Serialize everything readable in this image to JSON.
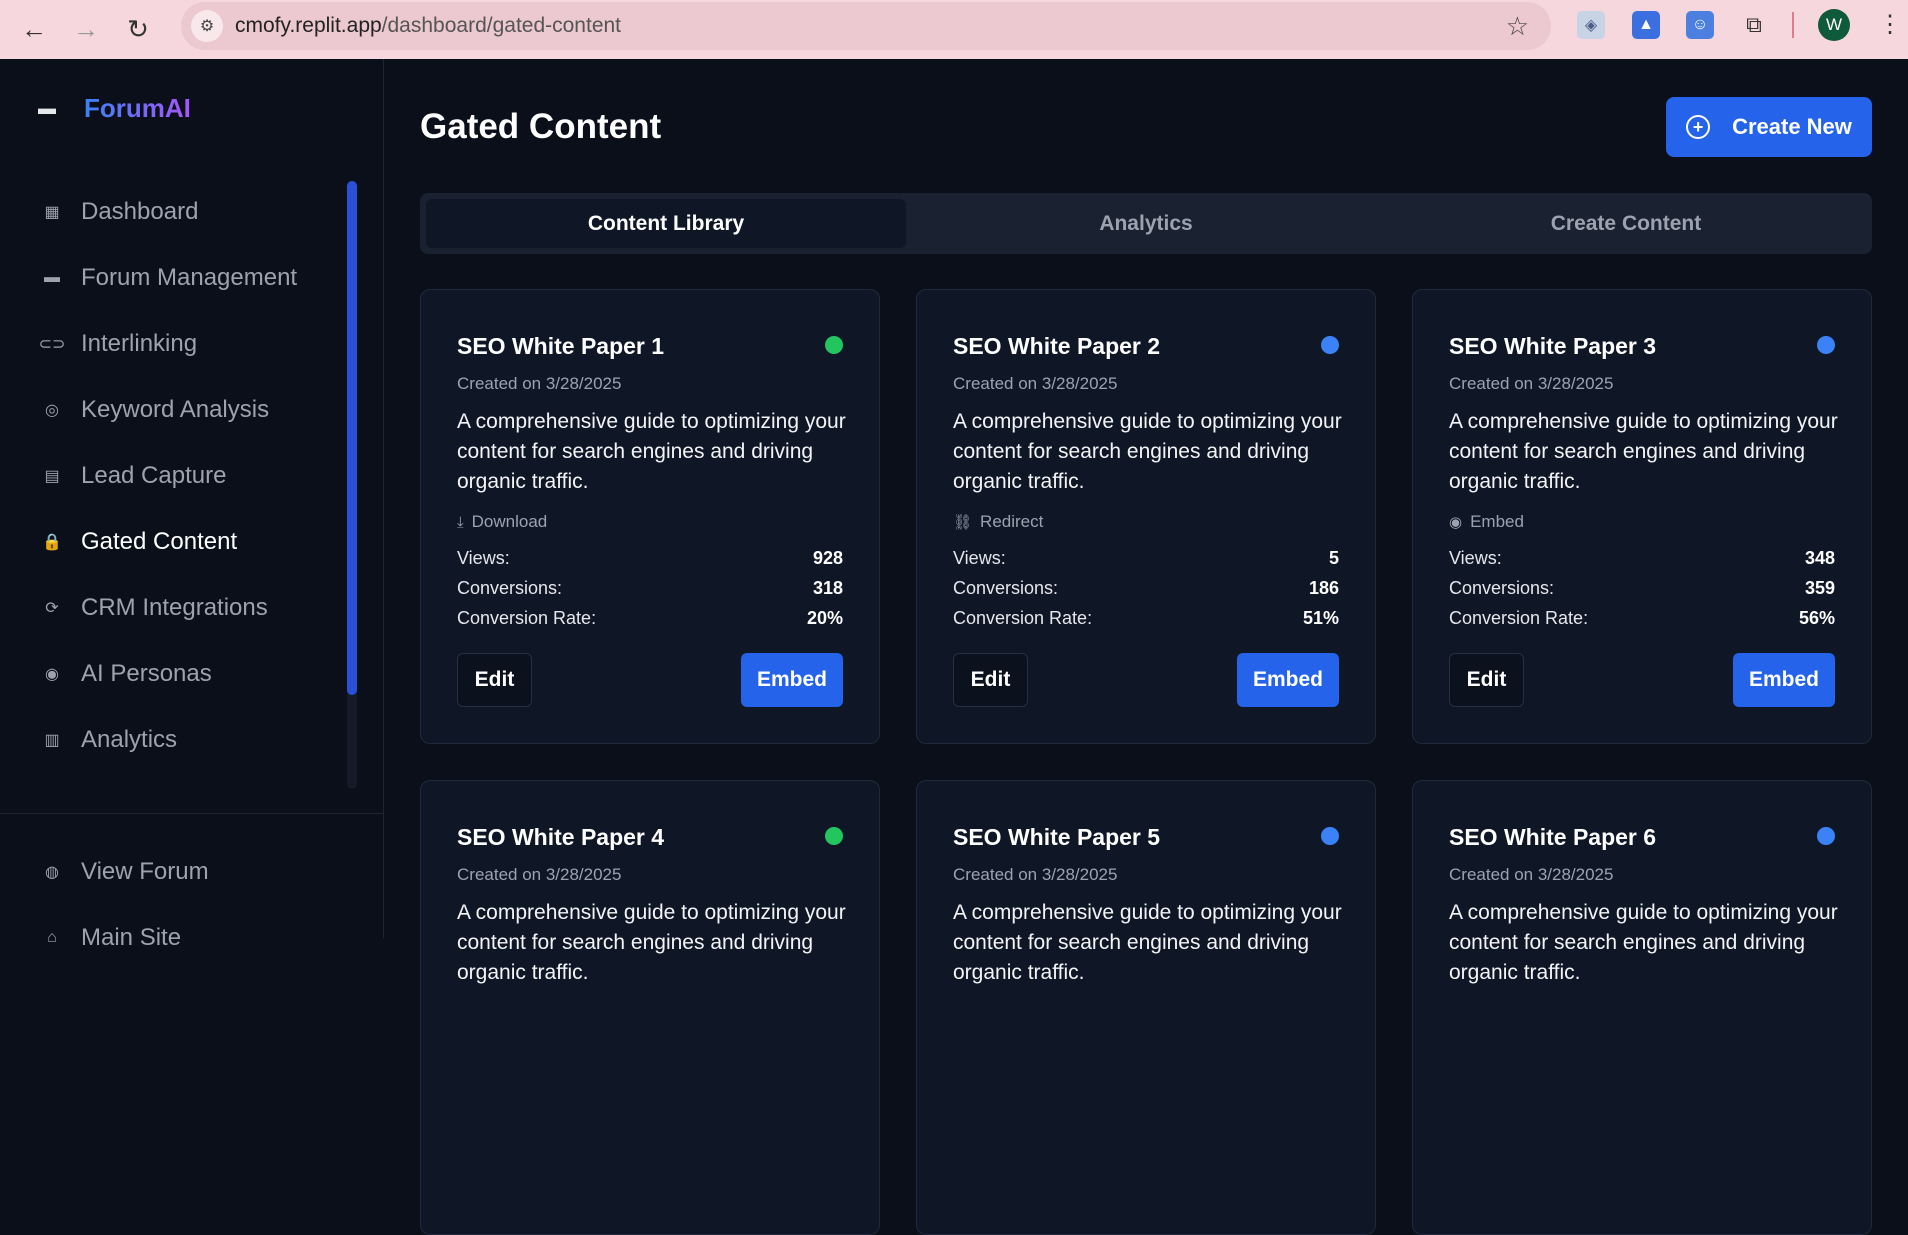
{
  "browser": {
    "url_host": "cmofy.replit.app",
    "url_path": "/dashboard/gated-content",
    "profile_initial": "W"
  },
  "sidebar": {
    "brand": "ForumAI",
    "items": [
      {
        "label": "Dashboard",
        "icon": "dashboard-icon",
        "glyph": "▦"
      },
      {
        "label": "Forum Management",
        "icon": "forum-icon",
        "glyph": "▬"
      },
      {
        "label": "Interlinking",
        "icon": "link-icon",
        "glyph": "⊂⊃"
      },
      {
        "label": "Keyword Analysis",
        "icon": "keyword-search-icon",
        "glyph": "◎"
      },
      {
        "label": "Lead Capture",
        "icon": "document-icon",
        "glyph": "▤"
      },
      {
        "label": "Gated Content",
        "icon": "lock-icon",
        "glyph": "🔒"
      },
      {
        "label": "CRM Integrations",
        "icon": "sync-icon",
        "glyph": "⟳"
      },
      {
        "label": "AI Personas",
        "icon": "persona-icon",
        "glyph": "◉"
      },
      {
        "label": "Analytics",
        "icon": "analytics-icon",
        "glyph": "▥"
      }
    ],
    "bottom_items": [
      {
        "label": "View Forum",
        "icon": "globe-icon",
        "glyph": "◍"
      },
      {
        "label": "Main Site",
        "icon": "home-icon",
        "glyph": "⌂"
      }
    ],
    "active_index": 5
  },
  "main": {
    "title": "Gated Content",
    "create_button": "Create New",
    "tabs": [
      "Content Library",
      "Analytics",
      "Create Content"
    ],
    "active_tab": 0,
    "labels": {
      "views": "Views:",
      "conversions": "Conversions:",
      "conversion_rate": "Conversion Rate:",
      "edit": "Edit",
      "embed": "Embed"
    },
    "cards": [
      {
        "title": "SEO White Paper 1",
        "status_color": "#22c55e",
        "date": "Created on 3/28/2025",
        "description": "A comprehensive guide to optimizing your content for search engines and driving organic traffic.",
        "type": "Download",
        "type_icon": "download-icon",
        "views": "928",
        "conversions": "318",
        "rate": "20%"
      },
      {
        "title": "SEO White Paper 2",
        "status_color": "#3b82f6",
        "date": "Created on 3/28/2025",
        "description": "A comprehensive guide to optimizing your content for search engines and driving organic traffic.",
        "type": "Redirect",
        "type_icon": "link-icon",
        "views": "5",
        "conversions": "186",
        "rate": "51%"
      },
      {
        "title": "SEO White Paper 3",
        "status_color": "#3b82f6",
        "date": "Created on 3/28/2025",
        "description": "A comprehensive guide to optimizing your content for search engines and driving organic traffic.",
        "type": "Embed",
        "type_icon": "eye-icon",
        "views": "348",
        "conversions": "359",
        "rate": "56%"
      },
      {
        "title": "SEO White Paper 4",
        "status_color": "#22c55e",
        "date": "Created on 3/28/2025",
        "description": "A comprehensive guide to optimizing your content for search engines and driving organic traffic."
      },
      {
        "title": "SEO White Paper 5",
        "status_color": "#3b82f6",
        "date": "Created on 3/28/2025",
        "description": "A comprehensive guide to optimizing your content for search engines and driving organic traffic."
      },
      {
        "title": "SEO White Paper 6",
        "status_color": "#3b82f6",
        "date": "Created on 3/28/2025",
        "description": "A comprehensive guide to optimizing your content for search engines and driving organic traffic."
      }
    ]
  }
}
